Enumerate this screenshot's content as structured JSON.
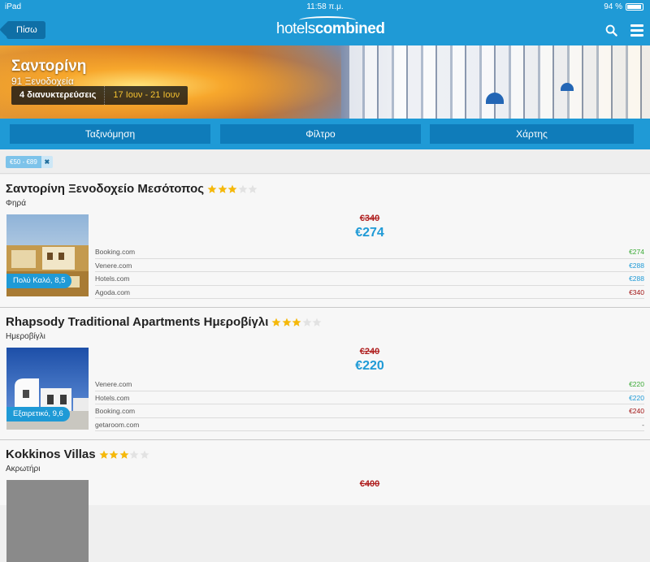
{
  "status": {
    "device": "iPad",
    "time": "11:58 π.μ.",
    "battery": "94 %"
  },
  "nav": {
    "back_label": "Πίσω",
    "logo_part1": "hotels",
    "logo_part2": "combined"
  },
  "hero": {
    "title": "Σαντορίνη",
    "subtitle": "91 Ξενοδοχεία",
    "guests": "4 διανυκτερεύσεις",
    "dates": "17 Ιουν - 21 Ιουν"
  },
  "actions": {
    "sort": "Ταξινόμηση",
    "filter": "Φίλτρο",
    "map": "Χάρτης"
  },
  "filter_chip": {
    "label": "€50 - €89",
    "remove": "✖"
  },
  "colors": {
    "brand": "#1f9ad6",
    "dark_brand": "#0f7cba",
    "best_price": "#3aa935",
    "higher_price": "#a11414",
    "star": "#f5b80a"
  },
  "listings": [
    {
      "name": "Σαντορίνη Ξενοδοχείο Μεσότοπος",
      "stars": 3,
      "location": "Φηρά",
      "rating": "Πολύ Καλό, 8,5",
      "old_price": "€340",
      "price": "€274",
      "providers": [
        {
          "name": "Booking.com",
          "price": "€274"
        },
        {
          "name": "Venere.com",
          "price": "€288"
        },
        {
          "name": "Hotels.com",
          "price": "€288"
        },
        {
          "name": "Agoda.com",
          "price": "€340"
        }
      ]
    },
    {
      "name": "Rhapsody Traditional Apartments Ημεροβίγλι",
      "stars": 3,
      "location": "Ημεροβίγλι",
      "rating": "Εξαιρετικό, 9,6",
      "old_price": "€240",
      "price": "€220",
      "providers": [
        {
          "name": "Venere.com",
          "price": "€220"
        },
        {
          "name": "Hotels.com",
          "price": "€220"
        },
        {
          "name": "Booking.com",
          "price": "€240"
        },
        {
          "name": "getaroom.com",
          "price": "-"
        }
      ]
    },
    {
      "name": "Kokkinos Villas",
      "stars": 3,
      "location": "Ακρωτήρι",
      "old_price": "€400"
    }
  ]
}
